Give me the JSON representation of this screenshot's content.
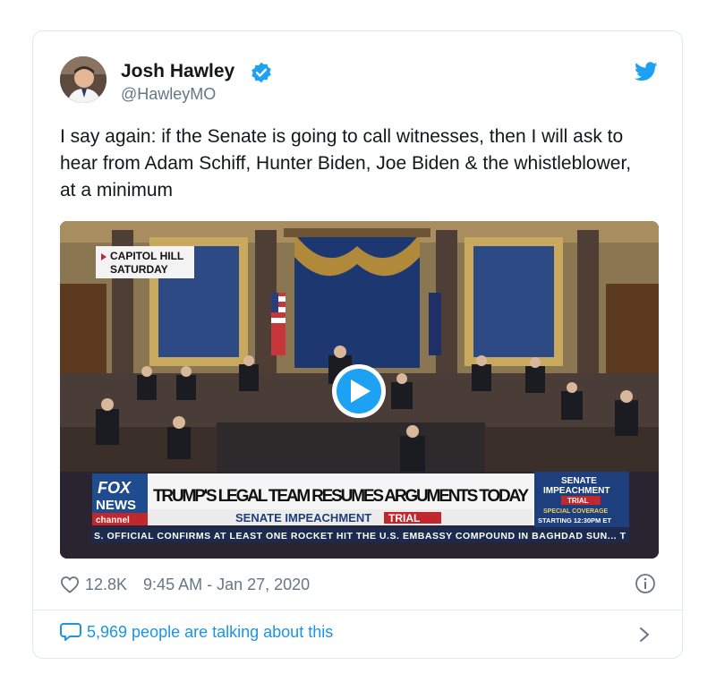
{
  "tweet": {
    "author_name": "Josh Hawley",
    "author_handle": "@HawleyMO",
    "text": "I say again: if the Senate is going to call witnesses, then I will ask to hear from Adam Schiff, Hunter Biden, Joe Biden & the whistleblower, at a minimum",
    "likes": "12.8K",
    "timestamp": "9:45 AM - Jan 27, 2020",
    "talking": "5,969 people are talking about this"
  },
  "video": {
    "corner_tag_line1": "CAPITOL HILL",
    "corner_tag_line2": "SATURDAY",
    "network_line1": "FOX",
    "network_line2": "NEWS",
    "network_line3": "channel",
    "headline": "TRUMP'S LEGAL TEAM RESUMES ARGUMENTS TODAY",
    "subheadline_a": "SENATE IMPEACHMENT",
    "subheadline_b": "TRIAL",
    "side_line1": "SENATE",
    "side_line2": "IMPEACHMENT",
    "side_line3": "TRIAL",
    "side_line4": "SPECIAL COVERAGE",
    "side_line5": "STARTING 12:30PM ET",
    "ticker": "S. OFFICIAL CONFIRMS AT LEAST ONE ROCKET HIT THE U.S. EMBASSY COMPOUND IN BAGHDAD SUN... T"
  },
  "colors": {
    "twitter_blue": "#1da1f2",
    "link_blue": "#1b95e0",
    "text_gray": "#657786"
  },
  "icons": [
    "verified-badge-icon",
    "twitter-bird-icon",
    "play-icon",
    "heart-icon",
    "info-icon",
    "speech-bubble-icon",
    "chevron-right-icon"
  ]
}
